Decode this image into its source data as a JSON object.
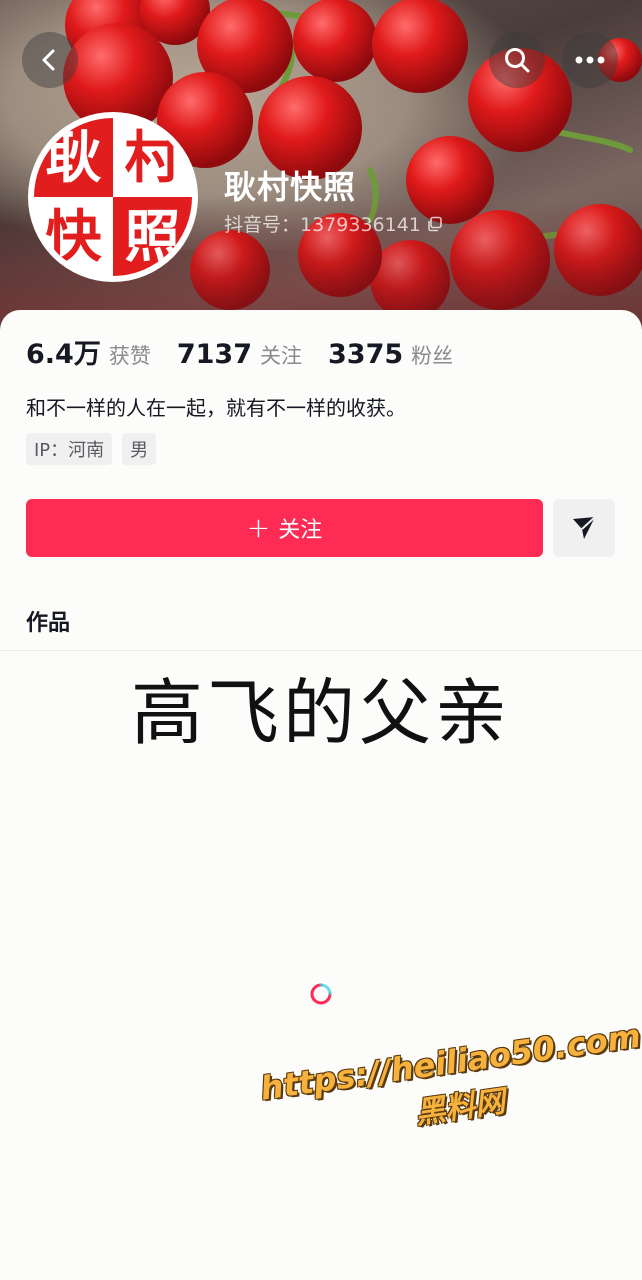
{
  "header": {
    "back_icon": "chevron-left-icon",
    "search_icon": "search-icon",
    "more_icon": "more-dots-icon",
    "cover_image": "cherries"
  },
  "profile": {
    "avatar_chars": [
      "耿",
      "村",
      "快",
      "照"
    ],
    "nickname": "耿村快照",
    "douyin_id": "抖音号：1379336141",
    "copy_icon": "copy-icon"
  },
  "stats": [
    {
      "value": "6.4万",
      "label": "获赞"
    },
    {
      "value": "7137",
      "label": "关注"
    },
    {
      "value": "3375",
      "label": "粉丝"
    }
  ],
  "bio": "和不一样的人在一起，就有不一样的收获。",
  "tags": [
    "IP：河南",
    "男"
  ],
  "actions": {
    "follow_plus": "+",
    "follow_label": "关注",
    "share_icon": "send-icon"
  },
  "tabs": {
    "works_label": "作品"
  },
  "content": {
    "video_title": "高飞的父亲"
  },
  "watermark": {
    "url": "https://heiliao50.com",
    "text": "黑料网"
  },
  "colors": {
    "accent": "#fe2c55",
    "avatar_red": "#e21d1d",
    "text_primary": "#161823",
    "text_secondary": "#8a8b91"
  }
}
